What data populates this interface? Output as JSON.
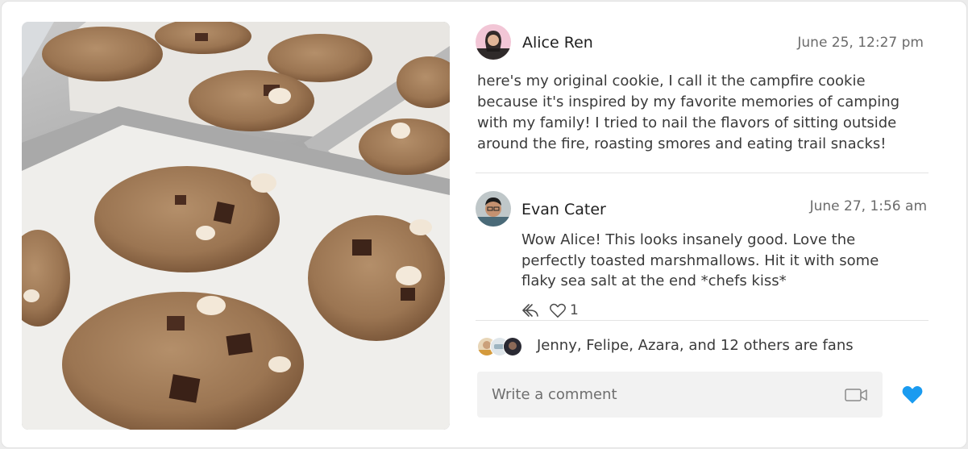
{
  "post": {
    "author": "Alice Ren",
    "timestamp": "June 25, 12:27 pm",
    "body": "here's my original cookie, I call it the campfire cookie because it's inspired by my favorite memories of camping with my family! I tried to nail the flavors of sitting outside around the fire, roasting smores and eating trail snacks!"
  },
  "comment": {
    "author": "Evan Cater",
    "timestamp": "June 27, 1:56 am",
    "body": "Wow Alice! This looks insanely good. Love the perfectly toasted marshmallows. Hit it with some flaky sea salt at the end *chefs kiss*",
    "like_count": "1",
    "icons": [
      "reply-icon",
      "heart-outline-icon"
    ]
  },
  "fans": {
    "text": "Jenny, Felipe, Azara, and 12 others are fans"
  },
  "composer": {
    "placeholder": "Write a comment",
    "icons": [
      "video-camera-icon",
      "heart-filled-icon"
    ]
  },
  "colors": {
    "accent": "#1a9bf0",
    "input_bg": "#f2f2f2",
    "divider": "#e4e4e4"
  }
}
